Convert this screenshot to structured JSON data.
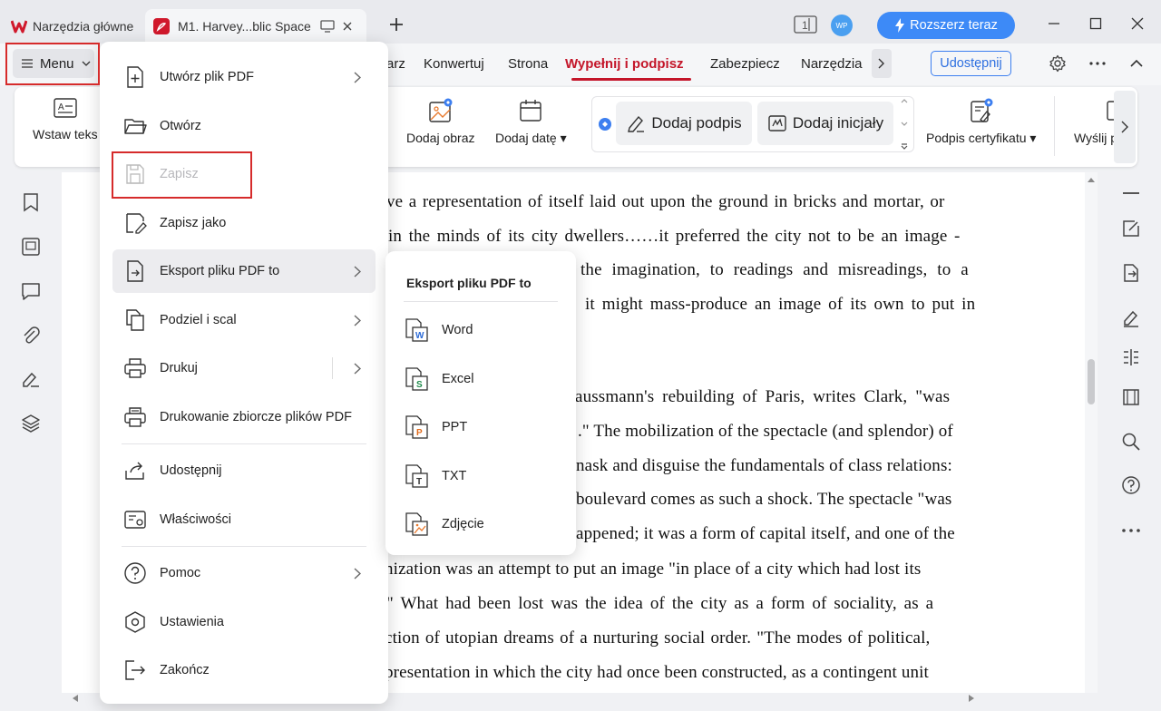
{
  "tabs": [
    {
      "label": "Narzędzia główne"
    },
    {
      "label": "M1. Harvey...blic Space"
    }
  ],
  "titlebar": {
    "upgrade_label": "Rozszerz teraz",
    "avatar_initials": "WP"
  },
  "menubar": {
    "menu_label": "Menu",
    "tabs": [
      "arz",
      "Konwertuj",
      "Strona",
      "Wypełnij i podpisz",
      "Zabezpiecz",
      "Narzędzia"
    ],
    "active_tab": "Wypełnij i podpisz",
    "share_label": "Udostępnij",
    "accent_color": "#c4162a"
  },
  "ribbon": {
    "insert_text": "Wstaw teks",
    "add_image": "Dodaj obraz",
    "add_date": "Dodaj datę",
    "add_signature": "Dodaj podpis",
    "add_initials": "Dodaj inicjały",
    "cert_signature": "Podpis certyfikatu",
    "send": "Wyślij p"
  },
  "menu": {
    "items": [
      {
        "label": "Utwórz plik PDF"
      },
      {
        "label": "Otwórz"
      },
      {
        "label": "Zapisz"
      },
      {
        "label": "Zapisz jako"
      },
      {
        "label": "Eksport pliku PDF to"
      },
      {
        "label": "Podziel i scal"
      },
      {
        "label": "Drukuj"
      },
      {
        "label": "Drukowanie zbiorcze plików PDF"
      },
      {
        "label": "Udostępnij"
      },
      {
        "label": "Właściwości"
      },
      {
        "label": "Pomoc"
      },
      {
        "label": "Ustawienia"
      },
      {
        "label": "Zakończ"
      }
    ]
  },
  "submenu": {
    "title": "Eksport pliku PDF to",
    "items": [
      {
        "label": "Word"
      },
      {
        "label": "Excel"
      },
      {
        "label": "PPT"
      },
      {
        "label": "TXT"
      },
      {
        "label": "Zdjęcie"
      }
    ]
  },
  "document": {
    "lines": [
      "ve a representation of itself laid out upon the ground in bricks and mortar, or",
      "in the minds of its city dwellers……it preferred the city not to be an image -",
      "the imagination, to readings and misreadings, to a",
      "it might mass-produce an image of its own to put in",
      "aussmann's rebuilding of Paris, writes Clark, \"was",
      ".\" The mobilization of the spectacle (and splendor) of",
      "nask and disguise the fundamentals of class relations:",
      "boulevard comes as such a shock.  The spectacle \"was",
      "appened; it was a form of capital itself, and one of the",
      "nization was an attempt to put an image \"in place of a city which had lost its",
      "\"  What had been lost was the idea of the city as a form of sociality, as a",
      "ction of utopian dreams of a nurturing social order. \"The modes of political,",
      "presentation in which the city had once been constructed, as a contingent unit"
    ]
  }
}
